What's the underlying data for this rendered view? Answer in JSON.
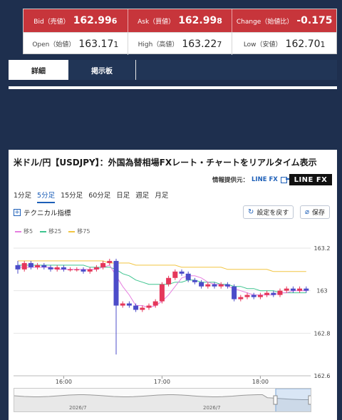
{
  "quote": {
    "bid": {
      "label": "Bid（売値）",
      "main": "162.99",
      "small": "6"
    },
    "ask": {
      "label": "Ask（買値）",
      "main": "162.99",
      "small": "8"
    },
    "change": {
      "label": "Change（始値比）",
      "value": "-0.175"
    },
    "open": {
      "label": "Open（始値）",
      "main": "163.17",
      "small": "1"
    },
    "high": {
      "label": "High（高値）",
      "main": "163.22",
      "small": "7"
    },
    "low": {
      "label": "Low（安値）",
      "main": "162.70",
      "small": "1"
    }
  },
  "tabs": [
    {
      "label": "詳細"
    },
    {
      "label": "掲示板"
    }
  ],
  "page": {
    "title": "米ドル/円【USDJPY】：外国為替相場FXレート・チャートをリアルタイム表示",
    "source_label": "情報提供元：",
    "source_link": "LINE FX",
    "logo": "LINE FX"
  },
  "periods": [
    "1分足",
    "5分足",
    "15分足",
    "60分足",
    "日足",
    "週足",
    "月足"
  ],
  "active_period": "5分足",
  "technical_label": "テクニカル指標",
  "buttons": {
    "reset": "設定を戻す",
    "save": "保存"
  },
  "legend": [
    {
      "name": "移5",
      "color": "#e67ee0"
    },
    {
      "name": "移25",
      "color": "#3ec48f"
    },
    {
      "name": "移75",
      "color": "#f2c542"
    }
  ],
  "navigator_labels": [
    "2026/7",
    "2026/7"
  ],
  "colors": {
    "up": "#e5375a",
    "down": "#4c4cc9",
    "accent": "#1d5fb8",
    "header_red": "#c7353b",
    "navy": "#213556"
  },
  "chart_data": {
    "type": "candlestick",
    "x_ticks": [
      "16:00",
      "17:00",
      "18:00"
    ],
    "y_ticks": [
      "163.2",
      "163",
      "162.8",
      "162.6"
    ],
    "ylim": [
      162.6,
      163.2
    ],
    "candles": [
      [
        163.12,
        163.1,
        163.14,
        163.08
      ],
      [
        163.1,
        163.13,
        163.14,
        163.09
      ],
      [
        163.13,
        163.11,
        163.14,
        163.1
      ],
      [
        163.11,
        163.12,
        163.13,
        163.1
      ],
      [
        163.12,
        163.11,
        163.13,
        163.1
      ],
      [
        163.11,
        163.1,
        163.12,
        163.09
      ],
      [
        163.1,
        163.11,
        163.12,
        163.09
      ],
      [
        163.11,
        163.1,
        163.12,
        163.09
      ],
      [
        163.1,
        163.1,
        163.11,
        163.09
      ],
      [
        163.1,
        163.1,
        163.11,
        163.09
      ],
      [
        163.1,
        163.09,
        163.11,
        163.08
      ],
      [
        163.09,
        163.1,
        163.11,
        163.08
      ],
      [
        163.1,
        163.11,
        163.12,
        163.09
      ],
      [
        163.11,
        163.13,
        163.14,
        163.1
      ],
      [
        163.13,
        163.14,
        163.15,
        163.12
      ],
      [
        163.14,
        162.93,
        163.15,
        162.7
      ],
      [
        162.93,
        162.94,
        162.95,
        162.92
      ],
      [
        162.94,
        162.93,
        162.95,
        162.92
      ],
      [
        162.93,
        162.91,
        162.94,
        162.9
      ],
      [
        162.91,
        162.92,
        162.93,
        162.9
      ],
      [
        162.92,
        162.93,
        162.94,
        162.91
      ],
      [
        162.93,
        162.95,
        162.96,
        162.92
      ],
      [
        162.95,
        163.03,
        163.04,
        162.94
      ],
      [
        163.03,
        163.06,
        163.07,
        163.02
      ],
      [
        163.06,
        163.09,
        163.1,
        163.05
      ],
      [
        163.09,
        163.08,
        163.1,
        163.07
      ],
      [
        163.08,
        163.05,
        163.09,
        163.04
      ],
      [
        163.05,
        163.04,
        163.06,
        163.03
      ],
      [
        163.04,
        163.02,
        163.05,
        163.01
      ],
      [
        163.02,
        163.03,
        163.04,
        163.01
      ],
      [
        163.03,
        163.02,
        163.04,
        163.01
      ],
      [
        163.02,
        163.03,
        163.04,
        163.01
      ],
      [
        163.03,
        163.02,
        163.04,
        163.01
      ],
      [
        163.02,
        162.96,
        163.03,
        162.95
      ],
      [
        162.96,
        162.97,
        162.98,
        162.95
      ],
      [
        162.97,
        162.98,
        162.99,
        162.96
      ],
      [
        162.98,
        162.97,
        162.99,
        162.96
      ],
      [
        162.97,
        162.98,
        162.99,
        162.96
      ],
      [
        162.98,
        162.99,
        163.0,
        162.97
      ],
      [
        162.99,
        162.98,
        163.0,
        162.97
      ],
      [
        162.98,
        163.0,
        163.01,
        162.97
      ],
      [
        163.0,
        163.01,
        163.02,
        162.99
      ],
      [
        163.01,
        163.0,
        163.02,
        162.99
      ],
      [
        163.0,
        163.01,
        163.02,
        162.99
      ],
      [
        163.01,
        163.0,
        163.02,
        162.99
      ]
    ],
    "ma5": [
      163.11,
      163.11,
      163.11,
      163.11,
      163.11,
      163.11,
      163.1,
      163.1,
      163.1,
      163.1,
      163.1,
      163.1,
      163.1,
      163.11,
      163.12,
      163.07,
      163.02,
      162.98,
      162.93,
      162.93,
      162.92,
      162.93,
      162.95,
      162.98,
      163.02,
      163.06,
      163.07,
      163.07,
      163.06,
      163.04,
      163.03,
      163.03,
      163.02,
      163.01,
      163.0,
      162.99,
      162.98,
      162.98,
      162.98,
      162.98,
      162.99,
      162.99,
      163.0,
      163.0,
      163.0
    ],
    "ma25": [
      163.12,
      163.12,
      163.12,
      163.12,
      163.12,
      163.12,
      163.12,
      163.12,
      163.12,
      163.12,
      163.12,
      163.11,
      163.11,
      163.11,
      163.11,
      163.1,
      163.08,
      163.07,
      163.05,
      163.04,
      163.03,
      163.03,
      163.03,
      163.03,
      163.04,
      163.04,
      163.05,
      163.05,
      163.04,
      163.04,
      163.04,
      163.03,
      163.03,
      163.02,
      163.02,
      163.01,
      163.01,
      163.0,
      163.0,
      163.0,
      162.99,
      162.99,
      162.99,
      162.99,
      162.99
    ],
    "ma75": [
      163.14,
      163.14,
      163.14,
      163.14,
      163.14,
      163.14,
      163.14,
      163.14,
      163.14,
      163.14,
      163.14,
      163.14,
      163.14,
      163.14,
      163.13,
      163.13,
      163.13,
      163.13,
      163.12,
      163.12,
      163.12,
      163.12,
      163.12,
      163.12,
      163.12,
      163.11,
      163.11,
      163.11,
      163.11,
      163.11,
      163.11,
      163.11,
      163.1,
      163.1,
      163.1,
      163.1,
      163.1,
      163.1,
      163.1,
      163.09,
      163.09,
      163.09,
      163.09,
      163.09,
      163.09
    ]
  }
}
